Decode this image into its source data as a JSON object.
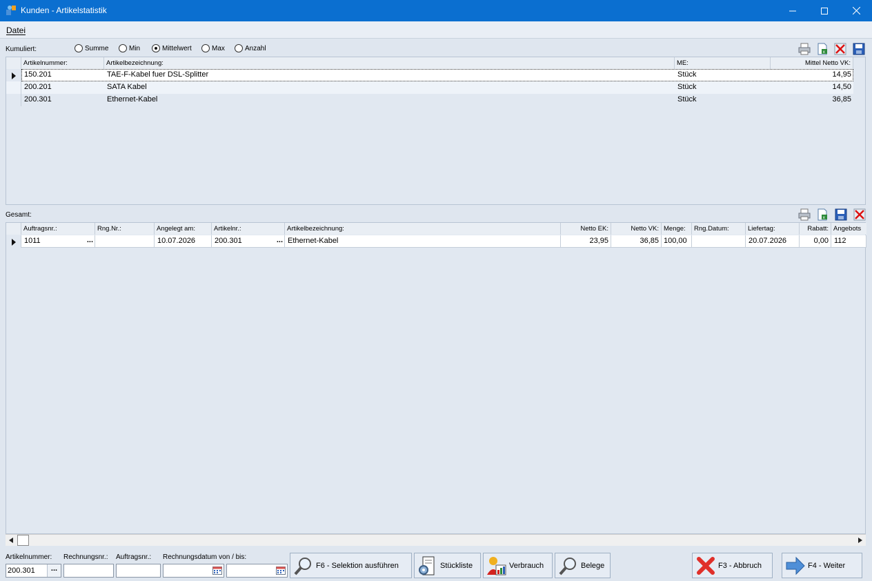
{
  "window": {
    "title": "Kunden - Artikelstatistik"
  },
  "menu": {
    "datei": "Datei"
  },
  "kumuliert": {
    "label": "Kumuliert:",
    "options": [
      "Summe",
      "Min",
      "Mittelwert",
      "Max",
      "Anzahl"
    ],
    "selected": "Mittelwert"
  },
  "top_grid": {
    "columns": [
      "Artikelnummer:",
      "Artikelbezeichnung:",
      "ME:",
      "Mittel Netto VK:"
    ],
    "rows": [
      [
        "150.201",
        "TAE-F-Kabel fuer DSL-Splitter",
        "Stück",
        "14,95"
      ],
      [
        "200.201",
        "SATA Kabel",
        "Stück",
        "14,50"
      ],
      [
        "200.301",
        "Ethernet-Kabel",
        "Stück",
        "36,85"
      ]
    ]
  },
  "gesamt": {
    "label": "Gesamt:"
  },
  "bottom_grid": {
    "columns": [
      "Auftragsnr.:",
      "Rng.Nr.:",
      "Angelegt am:",
      "Artikelnr.:",
      "Artikelbezeichnung:",
      "Netto EK:",
      "Netto VK:",
      "Menge:",
      "Rng.Datum:",
      "Liefertag:",
      "Rabatt:",
      "Angebots"
    ],
    "rows": [
      [
        "1011",
        "",
        "10.07.2026",
        "200.301",
        "Ethernet-Kabel",
        "23,95",
        "36,85",
        "100,00",
        "",
        "20.07.2026",
        "0,00",
        "112"
      ]
    ],
    "ellipsis": "..."
  },
  "filters": {
    "artikelnummer_label": "Artikelnummer:",
    "artikelnummer_value": "200.301",
    "rechnungsnr_label": "Rechnungsnr.:",
    "auftragsnr_label": "Auftragsnr.:",
    "rechnungsdatum_label": "Rechnungsdatum von / bis:",
    "ellipsis": "..."
  },
  "buttons": {
    "selektion": "F6 - Selektion ausführen",
    "stueckliste": "Stückliste",
    "verbrauch": "Verbrauch",
    "belege": "Belege",
    "abbruch": "F3 - Abbruch",
    "weiter": "F4 - Weiter"
  },
  "colors": {
    "titlebar": "#0b6fd0",
    "background": "#dfe6ef",
    "edit_cell": "#ffffff"
  }
}
